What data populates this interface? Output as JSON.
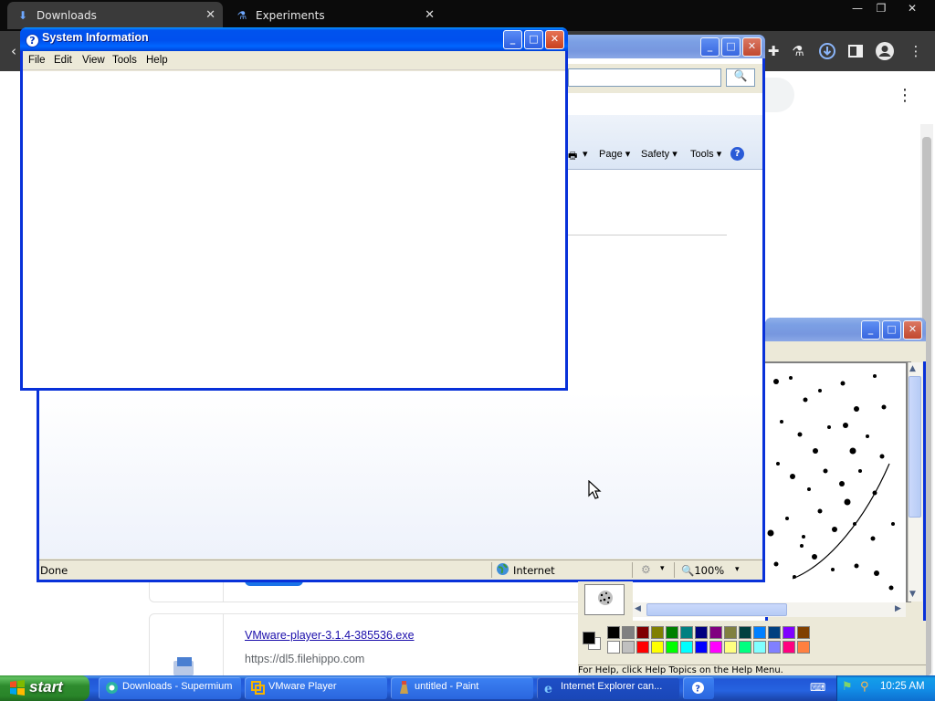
{
  "browser": {
    "tabs": [
      {
        "label": "Downloads",
        "icon": "download-icon",
        "close": "✕"
      },
      {
        "label": "Experiments",
        "icon": "flask-icon",
        "close": "✕"
      }
    ],
    "window_controls": [
      "—",
      "❐",
      "✕"
    ],
    "toolbar_icons": [
      "extensions-icon",
      "labs-icon",
      "downloads-icon",
      "sidepanel-icon",
      "profile-icon",
      "menu-icon"
    ],
    "page": {
      "menu_glyph": "⋮",
      "downloads": [
        {
          "file": "VMware-player-3.1.4-385536.exe",
          "url": "https://dl5.filehippo.com"
        }
      ]
    }
  },
  "ie": {
    "commands": {
      "page": "Page ▾",
      "safety": "Safety ▾",
      "tools": "Tools ▾",
      "print_arrow": "▾",
      "help": "?"
    },
    "search_glyph": "🔍",
    "status": {
      "left": "Done",
      "zone": "Internet",
      "zoom": "🔍100%",
      "zoom_arrow": "▾"
    }
  },
  "sysinfo": {
    "title": "System Information",
    "title_icon": "?",
    "menu": [
      "File",
      "Edit",
      "View",
      "Tools",
      "Help"
    ],
    "buttons": {
      "minimize": "_",
      "maximize": "□",
      "close": "✕"
    }
  },
  "paint": {
    "status": "For Help, click Help Topics on the Help Menu.",
    "palette_top": [
      "#000000",
      "#808080",
      "#800000",
      "#808000",
      "#008000",
      "#008080",
      "#000080",
      "#800080",
      "#808040",
      "#004040",
      "#0080ff",
      "#004080",
      "#8000ff",
      "#804000"
    ],
    "palette_bottom": [
      "#ffffff",
      "#c0c0c0",
      "#ff0000",
      "#ffff00",
      "#00ff00",
      "#00ffff",
      "#0000ff",
      "#ff00ff",
      "#ffff80",
      "#00ff80",
      "#80ffff",
      "#8080ff",
      "#ff0080",
      "#ff8040"
    ]
  },
  "taskbar": {
    "start": "start",
    "buttons": [
      {
        "label": "Downloads - Supermium",
        "icon": "supermium-icon"
      },
      {
        "label": "VMware Player",
        "icon": "vmware-icon"
      },
      {
        "label": "untitled - Paint",
        "icon": "paint-icon"
      },
      {
        "label": "Internet Explorer can...",
        "icon": "ie-icon"
      },
      {
        "label": "",
        "icon": "help-icon"
      }
    ],
    "clock": "10:25 AM"
  },
  "colors": {
    "xp_title_blue": "#0053ee",
    "xp_taskbar_blue": "#2663e0",
    "start_green": "#2e8b2e",
    "chrome_dark": "#3a3a3a",
    "link_blue": "#1a0dab"
  }
}
